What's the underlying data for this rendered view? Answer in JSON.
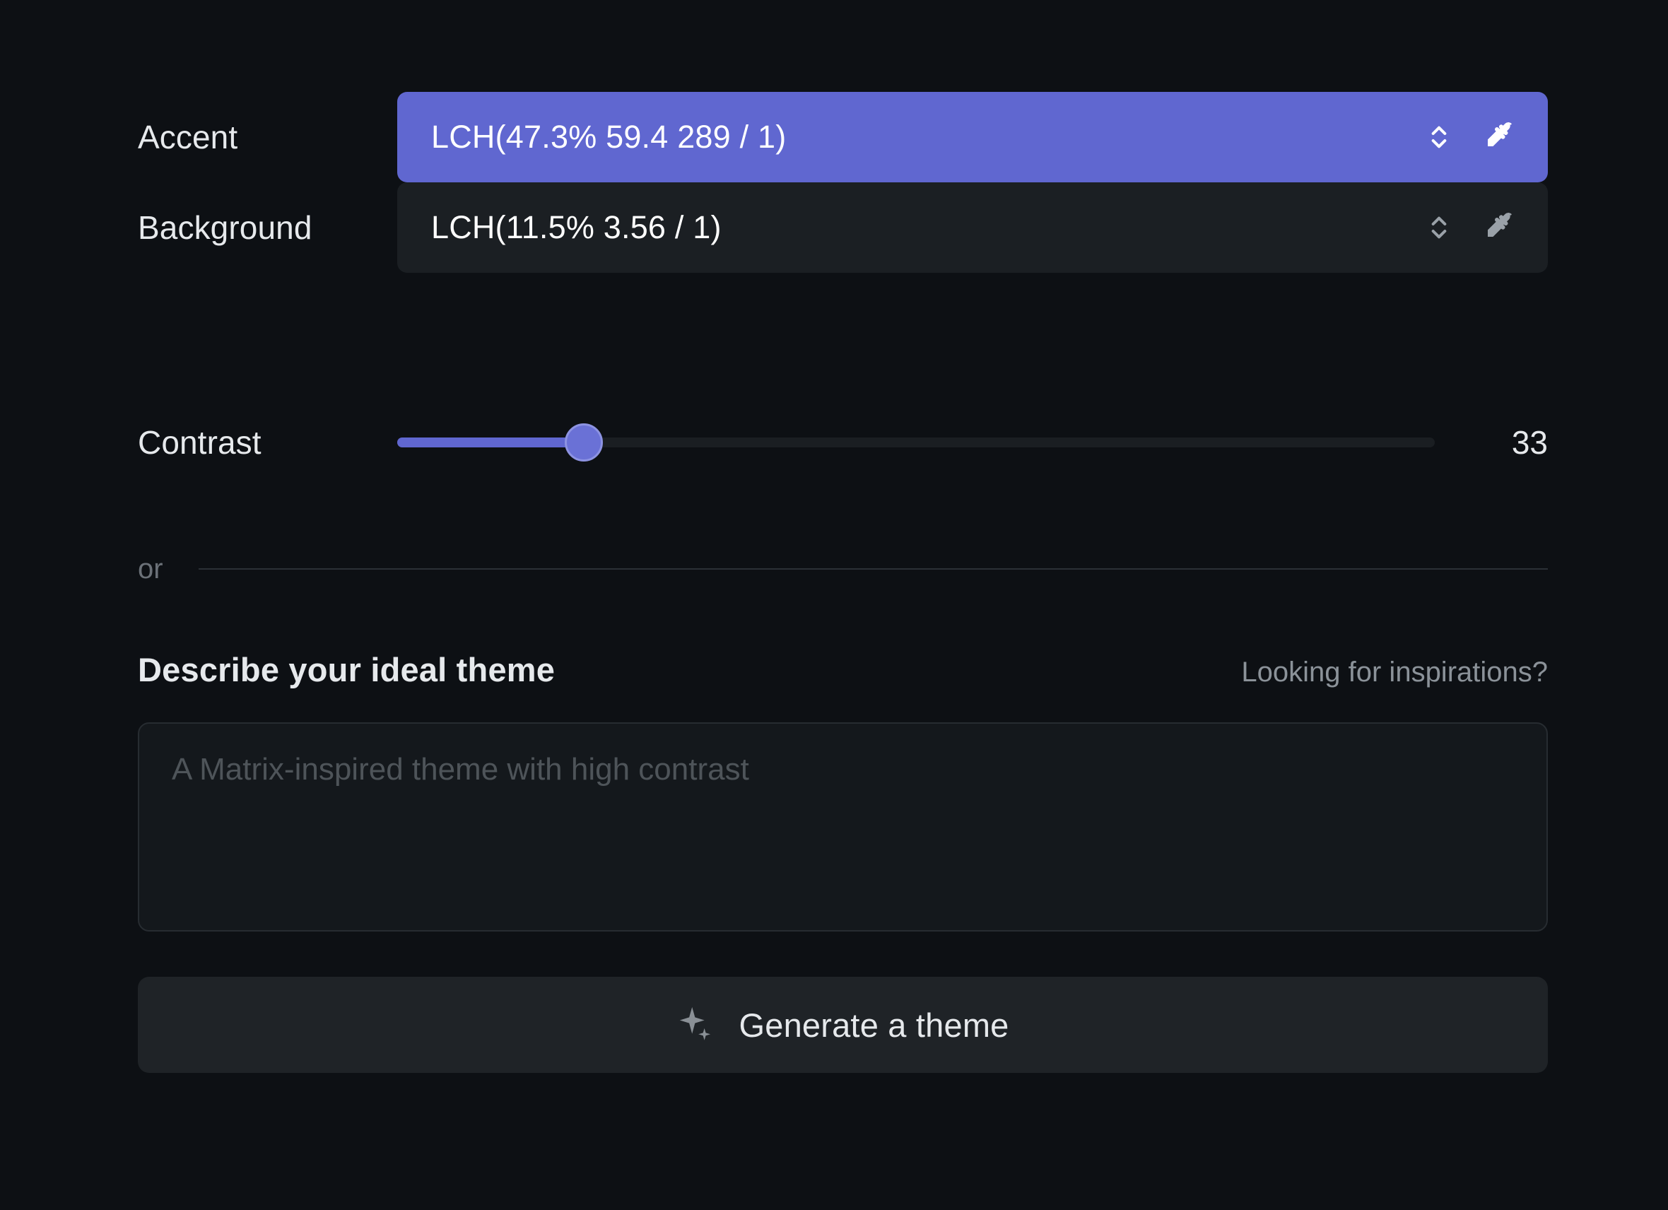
{
  "fields": {
    "accent": {
      "label": "Accent",
      "value": "LCH(47.3% 59.4 289 / 1)",
      "swatch_hex": "#6067d0",
      "stepper_icon": "chevron-up-down-icon",
      "picker_icon": "eyedropper-icon"
    },
    "background": {
      "label": "Background",
      "value": "LCH(11.5% 3.56 / 1)",
      "swatch_hex": "#1b1f23",
      "stepper_icon": "chevron-up-down-icon",
      "picker_icon": "eyedropper-icon"
    },
    "contrast": {
      "label": "Contrast",
      "value": "33",
      "min": 0,
      "max": 100,
      "percent": 18
    }
  },
  "divider": {
    "label": "or"
  },
  "describe": {
    "title": "Describe your ideal theme",
    "link": "Looking for inspirations?",
    "placeholder": "A Matrix-inspired theme with high contrast",
    "value": ""
  },
  "generate": {
    "label": "Generate a theme",
    "icon": "sparkles-icon"
  },
  "colors": {
    "page_bg": "#0d1014",
    "field_bg": "#1b1f23",
    "accent": "#6067d0",
    "button_bg": "#1f2327",
    "text": "#e6e9ec",
    "text_dim": "#9aa1a8"
  }
}
